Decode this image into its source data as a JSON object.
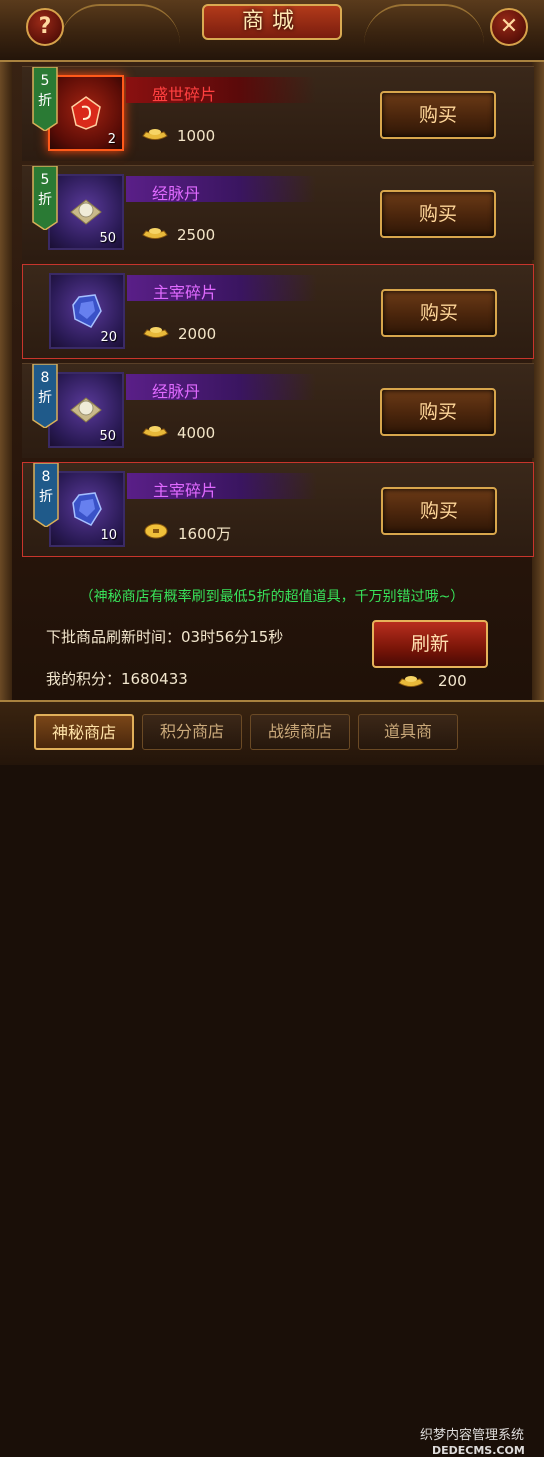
{
  "window": {
    "title": "商城",
    "help_label": "?",
    "close_label": "✕"
  },
  "items": [
    {
      "discount_num": "5",
      "discount_word": "折",
      "badge_color": "#2a7a34",
      "name": "盛世碎片",
      "name_style": "red",
      "count": "2",
      "price": "1000",
      "currency_icon": "gold-ingot-icon",
      "buy_label": "购买"
    },
    {
      "discount_num": "5",
      "discount_word": "折",
      "badge_color": "#2a7a34",
      "name": "经脉丹",
      "name_style": "purple",
      "count": "50",
      "price": "2500",
      "currency_icon": "gold-ingot-icon",
      "buy_label": "购买"
    },
    {
      "discount_num": "",
      "discount_word": "",
      "badge_color": "",
      "name": "主宰碎片",
      "name_style": "purple",
      "count": "20",
      "price": "2000",
      "currency_icon": "gold-ingot-icon",
      "buy_label": "购买"
    },
    {
      "discount_num": "8",
      "discount_word": "折",
      "badge_color": "#1f5a8a",
      "name": "经脉丹",
      "name_style": "purple",
      "count": "50",
      "price": "4000",
      "currency_icon": "gold-ingot-icon",
      "buy_label": "购买"
    },
    {
      "discount_num": "8",
      "discount_word": "折",
      "badge_color": "#1f5a8a",
      "name": "主宰碎片",
      "name_style": "purple",
      "count": "10",
      "price": "1600万",
      "currency_icon": "copper-coin-icon",
      "buy_label": "购买"
    }
  ],
  "notice": "（神秘商店有概率刷到最低5折的超值道具，千万别错过哦~）",
  "refresh": {
    "timer_text": "下批商品刷新时间：03时56分15秒",
    "button_label": "刷新",
    "cost": "200"
  },
  "points_text": "我的积分：1680433",
  "tabs": [
    {
      "label": "神秘商店",
      "active": true
    },
    {
      "label": "积分商店",
      "active": false
    },
    {
      "label": "战绩商店",
      "active": false
    },
    {
      "label": "道具商",
      "active": false
    }
  ],
  "watermark": {
    "line1": "织梦内容管理系统",
    "line2": "DEDECMS.COM"
  }
}
